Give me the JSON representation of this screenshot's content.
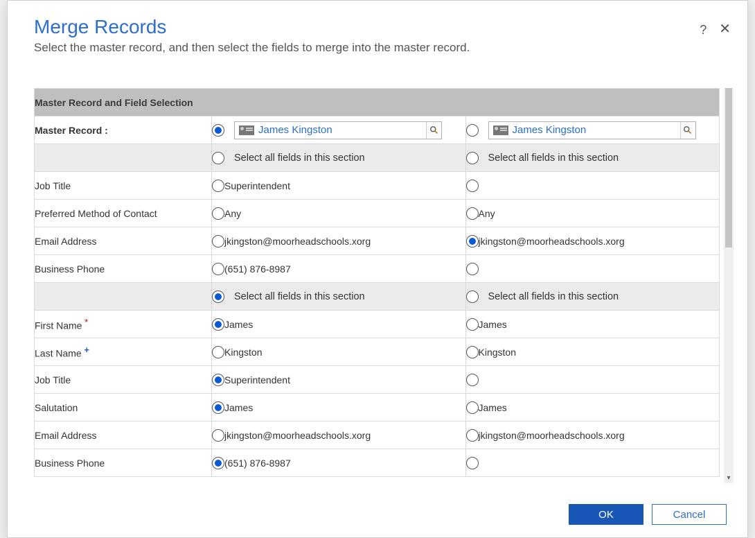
{
  "dialog": {
    "title": "Merge Records",
    "subtitle": "Select the master record, and then select the fields to merge into the master record."
  },
  "buttons": {
    "ok": "OK",
    "cancel": "Cancel"
  },
  "section_header": "Master Record and Field Selection",
  "labels": {
    "master_record": "Master Record :",
    "select_all": "Select all fields in this section"
  },
  "records": {
    "left": {
      "name": "James Kingston",
      "is_master": true
    },
    "right": {
      "name": "James Kingston",
      "is_master": false
    }
  },
  "rows": [
    {
      "kind": "selectall",
      "left_checked": false,
      "right_checked": false
    },
    {
      "kind": "field",
      "label": "Job Title",
      "left": "Superintendent",
      "right": "",
      "left_checked": false,
      "right_checked": false
    },
    {
      "kind": "field",
      "label": "Preferred Method of Contact",
      "left": "Any",
      "right": "Any",
      "left_checked": false,
      "right_checked": false
    },
    {
      "kind": "field",
      "label": "Email Address",
      "left": "jkingston@moorheadschools.xorg",
      "right": "jkingston@moorheadschools.xorg",
      "left_checked": false,
      "right_checked": true
    },
    {
      "kind": "field",
      "label": "Business Phone",
      "left": "(651) 876-8987",
      "right": "",
      "left_checked": false,
      "right_checked": false
    },
    {
      "kind": "selectall",
      "left_checked": true,
      "right_checked": false
    },
    {
      "kind": "field",
      "label": "First Name",
      "mark": "req",
      "left": "James",
      "right": "James",
      "left_checked": true,
      "right_checked": false
    },
    {
      "kind": "field",
      "label": "Last Name",
      "mark": "add",
      "left": "Kingston",
      "right": "Kingston",
      "left_checked": false,
      "right_checked": false
    },
    {
      "kind": "field",
      "label": "Job Title",
      "left": "Superintendent",
      "right": "",
      "left_checked": true,
      "right_checked": false
    },
    {
      "kind": "field",
      "label": "Salutation",
      "left": "James",
      "right": "James",
      "left_checked": true,
      "right_checked": false
    },
    {
      "kind": "field",
      "label": "Email Address",
      "left": "jkingston@moorheadschools.xorg",
      "right": "jkingston@moorheadschools.xorg",
      "left_checked": false,
      "right_checked": false
    },
    {
      "kind": "field",
      "label": "Business Phone",
      "left": "(651) 876-8987",
      "right": "",
      "left_checked": true,
      "right_checked": false
    }
  ]
}
